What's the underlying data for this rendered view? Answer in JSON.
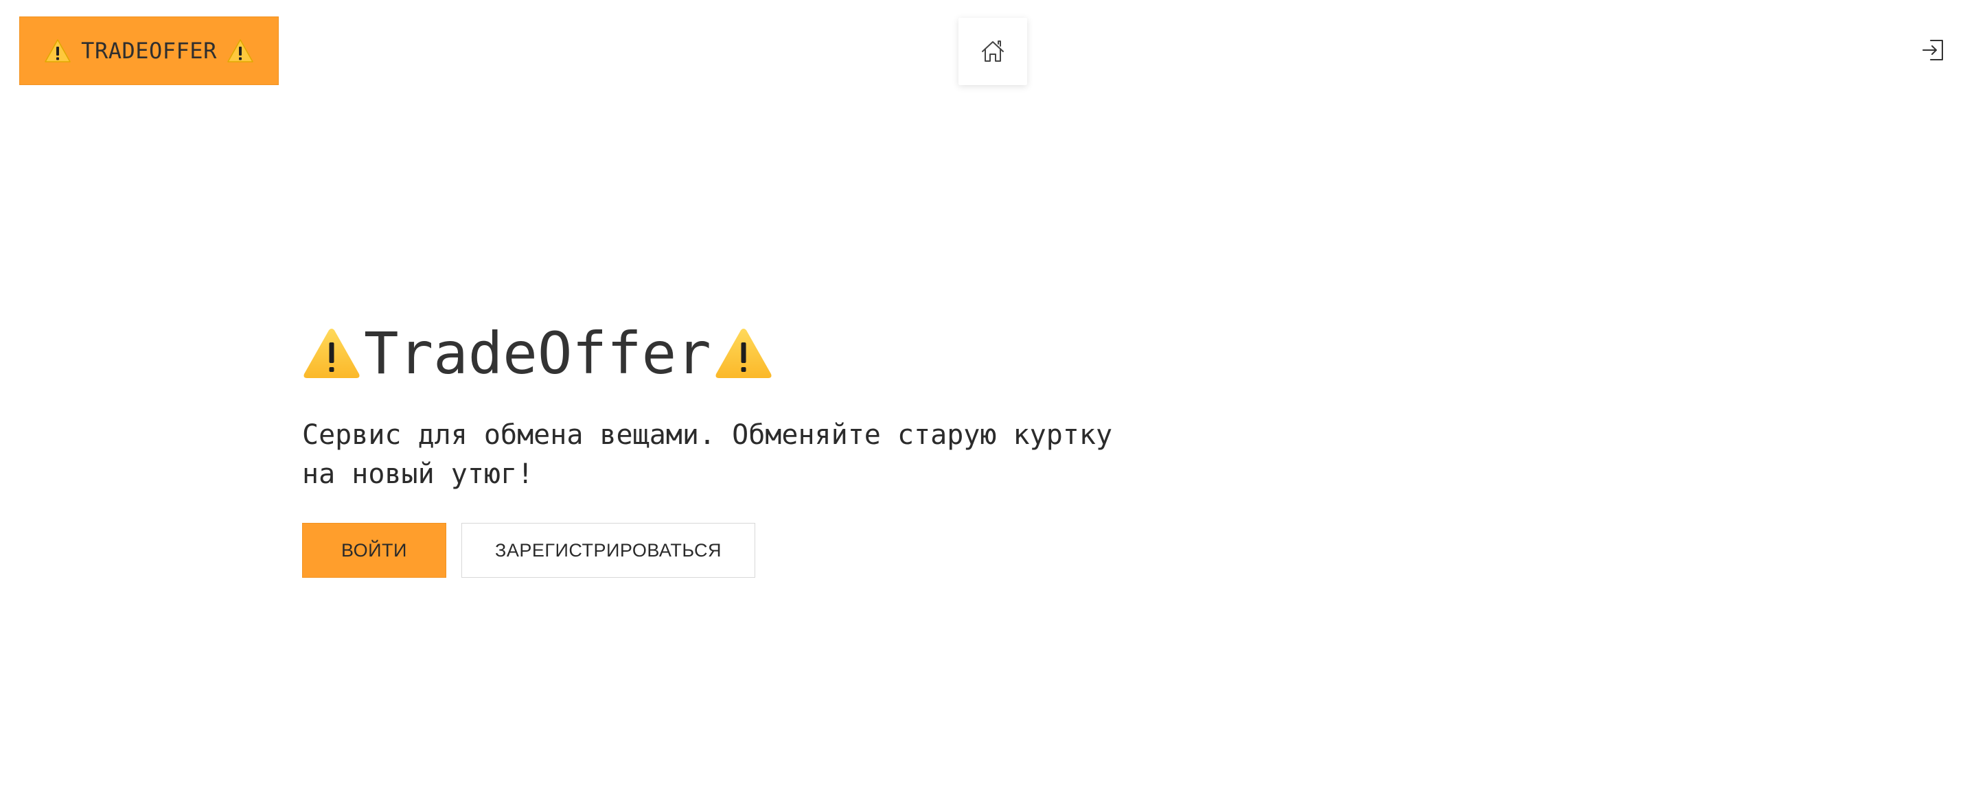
{
  "header": {
    "brand_label": "TRADEOFFER",
    "brand_icon": "warning-icon",
    "home_icon": "home-icon",
    "login_icon": "sign-in-icon"
  },
  "hero": {
    "title": "TradeOffer",
    "description": "Сервис для обмена вещами. Обменяйте старую куртку на новый утюг!",
    "login_label": "ВОЙТИ",
    "register_label": "ЗАРЕГИСТРИРОВАТЬСЯ"
  },
  "colors": {
    "accent": "#ff9e2c",
    "warning_yellow": "#ffc83d",
    "text": "#333333"
  }
}
